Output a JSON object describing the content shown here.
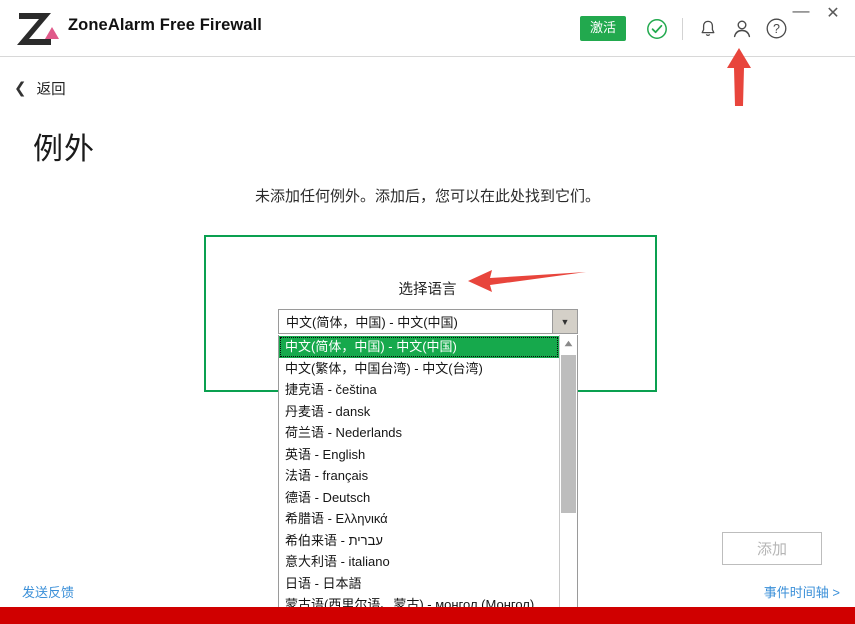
{
  "window": {
    "minimize_label": "—",
    "close_label": "✕"
  },
  "header": {
    "brand_title": "ZoneAlarm Free Firewall",
    "logo_icon": "zonealarm-logo-icon",
    "activate_label": "激活",
    "status_icon": "check-circle-icon",
    "notifications_icon": "bell-icon",
    "account_icon": "person-icon",
    "help_icon": "question-mark-icon",
    "accent_green": "#22a94e"
  },
  "nav": {
    "back_icon": "chevron-left-icon",
    "back_label": "返回"
  },
  "page": {
    "title": "例外",
    "empty_message": "未添加任何例外。添加后，您可以在此处找到它们。"
  },
  "language_dialog": {
    "panel_border_color": "#0aa050",
    "label": "选择语言",
    "combo_value": "中文(简体，中国) - 中文(中国)",
    "combo_arrow_icon": "chevron-down-icon",
    "scroll_up_icon": "scroll-up-arrow-icon",
    "selected_index": 0,
    "options": [
      "中文(简体，中国) - 中文(中国)",
      "中文(繁体，中国台湾) - 中文(台湾)",
      "捷克语 - čeština",
      "丹麦语 - dansk",
      "荷兰语 - Nederlands",
      "英语 - English",
      "法语 - français",
      "德语 - Deutsch",
      "希腊语 - Ελληνικά",
      "希伯来语 - עברית",
      "意大利语 - italiano",
      "日语 - 日本語",
      "蒙古语(西里尔语、蒙古) - монгол (Монгол)"
    ]
  },
  "footer": {
    "add_label": "添加",
    "timeline_label": "事件时间轴 >",
    "feedback_label": "发送反馈",
    "bar_color": "#d00000"
  },
  "annotations": {
    "arrow_color": "#e8453c",
    "arrow_account_icon": "red-up-arrow-icon",
    "arrow_language_label_icon": "red-left-arrow-icon"
  }
}
